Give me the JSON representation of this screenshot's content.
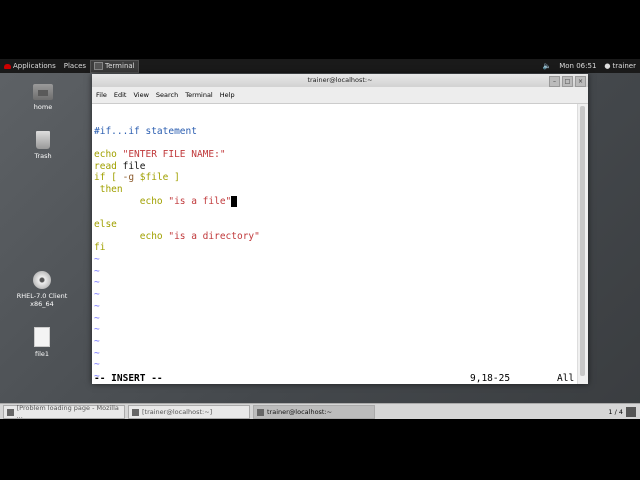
{
  "top_panel": {
    "applications_label": "Applications",
    "places_label": "Places",
    "active_app_label": "Terminal",
    "clock": "Mon 06:51",
    "user": "trainer"
  },
  "desktop": {
    "icons": [
      {
        "label": "home",
        "icon": "folder-icon"
      },
      {
        "label": "Trash",
        "icon": "trash-icon"
      },
      {
        "label_line1": "RHEL-7.0 Client",
        "label_line2": "x86_64",
        "icon": "disc-icon"
      },
      {
        "label": "file1",
        "icon": "file-icon"
      }
    ]
  },
  "window": {
    "title": "trainer@localhost:~",
    "menu": [
      "File",
      "Edit",
      "View",
      "Search",
      "Terminal",
      "Help"
    ]
  },
  "editor": {
    "lines": {
      "l1": "#if...if statement",
      "l2a": "echo",
      "l2b": " \"ENTER FILE NAME:\"",
      "l3a": "read",
      "l3b": " file",
      "l4a": "if [ ",
      "l4b": "-g",
      "l4c": " $file ]",
      "l5": " then",
      "l6a": "        echo ",
      "l6b": "\"is a file\"",
      "l7": "else",
      "l8a": "        echo ",
      "l8b": "\"is a directory\"",
      "l9": "fi"
    },
    "tilde": "~",
    "colors": {
      "comment": "#2a5db0",
      "keyword": "#a0a000",
      "string": "#c0393b",
      "option": "#8b5a2b"
    },
    "status_mode": "-- INSERT --",
    "status_position": "9,18-25",
    "status_scroll": "All"
  },
  "taskbar": {
    "tasks": [
      {
        "label": "[Problem loading page - Mozilla ...",
        "active": false
      },
      {
        "label": "[trainer@localhost:~]",
        "active": false
      },
      {
        "label": "trainer@localhost:~",
        "active": true
      }
    ],
    "workspace": "1 / 4"
  }
}
